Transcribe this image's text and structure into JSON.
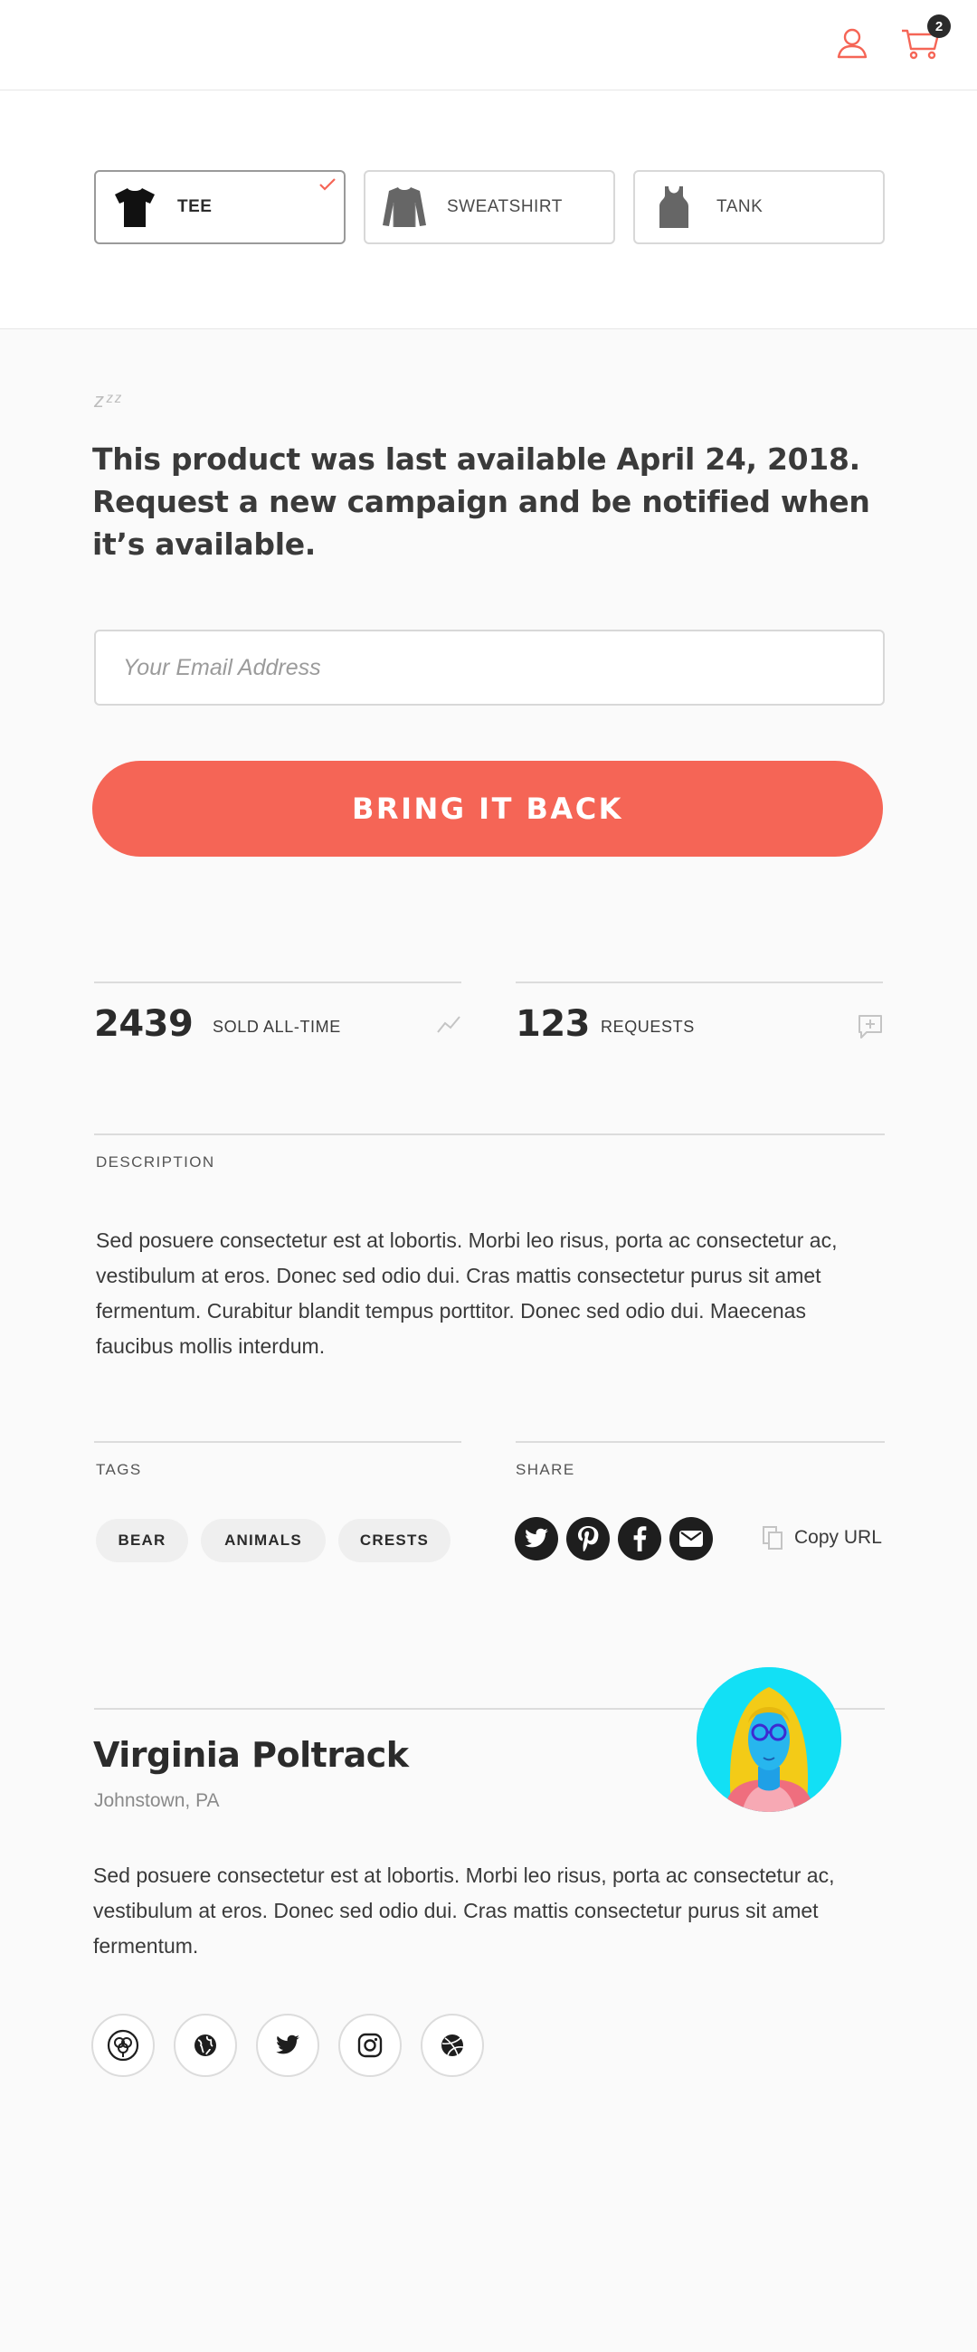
{
  "header": {
    "cart_count": "2",
    "accent": "#f56556",
    "icons": [
      "user-icon",
      "cart-icon"
    ]
  },
  "product_types": [
    {
      "label": "TEE",
      "selected": true,
      "icon": "tshirt-icon"
    },
    {
      "label": "SWEATSHIRT",
      "selected": false,
      "icon": "sweatshirt-icon"
    },
    {
      "label": "TANK",
      "selected": false,
      "icon": "tank-icon"
    }
  ],
  "unavailable": {
    "zzz": "zᶻᶻ",
    "message": "This product was last available April 24, 2018. Request a new campaign and be notified when it’s available.",
    "email_placeholder": "Your Email Address",
    "cta_label": "BRING IT BACK",
    "cta_color": "#f56556"
  },
  "stats": {
    "sold_value": "2439",
    "sold_label": "SOLD ALL-TIME",
    "requests_value": "123",
    "requests_label": "REQUESTS"
  },
  "description": {
    "label": "DESCRIPTION",
    "body": "Sed posuere consectetur est at lobortis. Morbi leo risus, porta ac consectetur ac, vestibulum at eros. Donec sed odio dui. Cras mattis consectetur purus sit amet fermentum. Curabitur blandit tempus porttitor. Donec sed odio dui. Maecenas faucibus mollis interdum."
  },
  "tags": {
    "label": "TAGS",
    "items": [
      "BEAR",
      "ANIMALS",
      "CRESTS"
    ]
  },
  "share": {
    "label": "SHARE",
    "networks": [
      "twitter-icon",
      "pinterest-icon",
      "facebook-icon",
      "email-icon"
    ],
    "copy_label": "Copy URL"
  },
  "artist": {
    "name": "Virginia Poltrack",
    "location": "Johnstown, PA",
    "bio": "Sed posuere consectetur est at lobortis. Morbi leo risus, porta ac consectetur ac, vestibulum at eros. Donec sed odio dui. Cras mattis consectetur purus sit amet fermentum.",
    "links": [
      "threadless-icon",
      "globe-icon",
      "twitter-icon",
      "instagram-icon",
      "dribbble-icon"
    ]
  }
}
